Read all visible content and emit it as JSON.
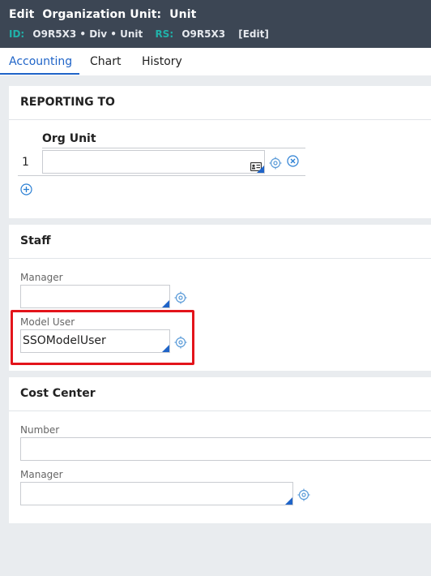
{
  "header": {
    "title": "Edit  Organization Unit:  Unit",
    "id_key": "ID:",
    "id_value": "O9R5X3 • Div • Unit",
    "rs_key": "RS:",
    "rs_value": "O9R5X3",
    "edit_link": "[Edit]"
  },
  "tabs": [
    {
      "label": "Accounting",
      "active": true
    },
    {
      "label": "Chart",
      "active": false
    },
    {
      "label": "History",
      "active": false
    }
  ],
  "reporting": {
    "title": "REPORTING TO",
    "column_header": "Org Unit",
    "rows": [
      {
        "index": "1",
        "value": ""
      }
    ]
  },
  "staff": {
    "title": "Staff",
    "manager_label": "Manager",
    "manager_value": "",
    "model_user_label": "Model User",
    "model_user_value": "SSOModelUser"
  },
  "cost_center": {
    "title": "Cost Center",
    "number_label": "Number",
    "number_value": "",
    "manager_label": "Manager",
    "manager_value": ""
  },
  "colors": {
    "header_bg": "#3c4654",
    "accent": "#1f64c8",
    "key_teal": "#20b2aa",
    "highlight_red": "#e3141b"
  },
  "icons": [
    "card-icon",
    "target-icon",
    "remove-circle-icon",
    "add-circle-icon"
  ]
}
